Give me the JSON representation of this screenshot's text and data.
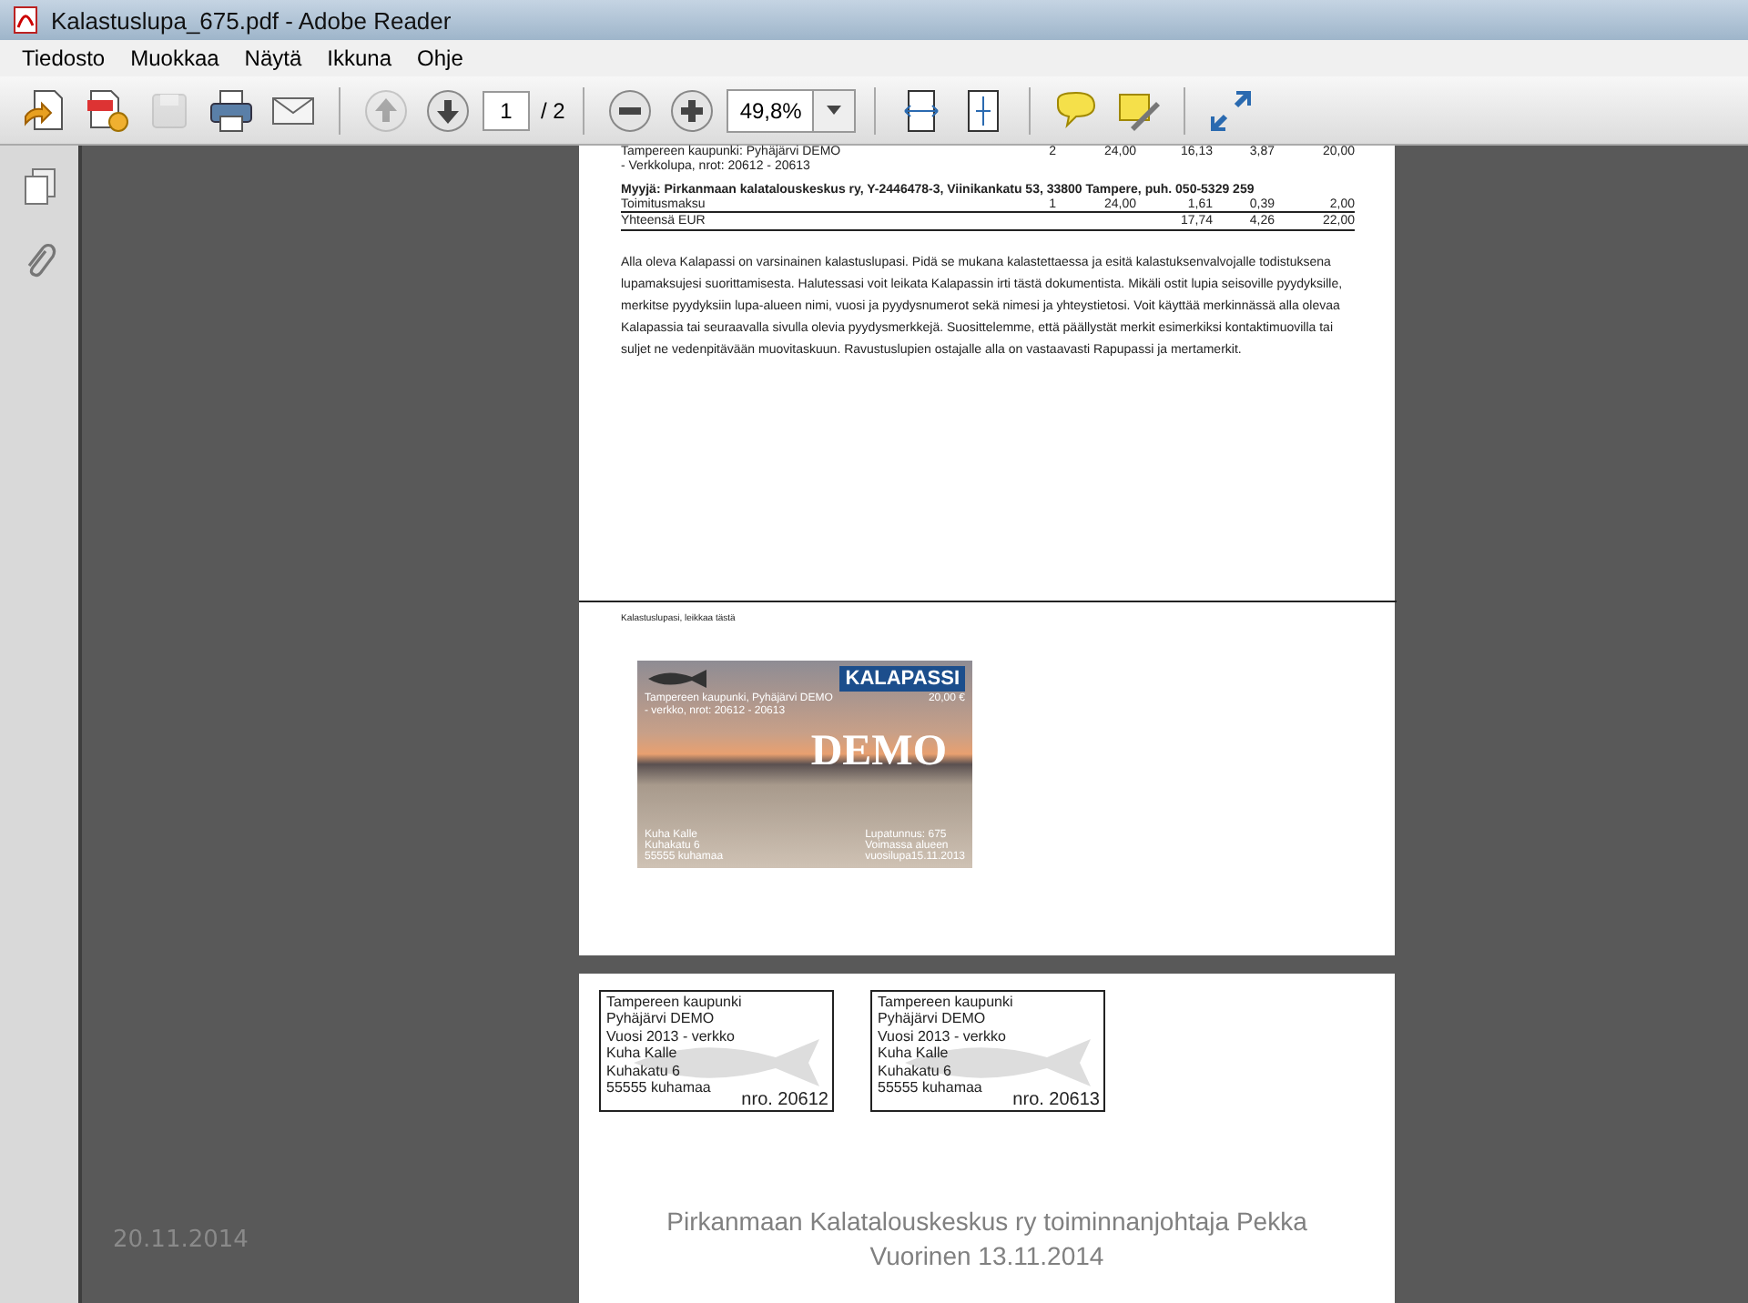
{
  "window": {
    "title": "Kalastuslupa_675.pdf - Adobe Reader"
  },
  "menu": [
    "Tiedosto",
    "Muokkaa",
    "Näytä",
    "Ikkuna",
    "Ohje"
  ],
  "toolbar": [
    {
      "items": [
        {
          "kind": "create",
          "disabled": false
        },
        {
          "kind": "convert",
          "disabled": false
        },
        {
          "kind": "save",
          "disabled": true
        },
        {
          "kind": "print",
          "disabled": false
        },
        {
          "kind": "email",
          "disabled": false
        }
      ]
    },
    {
      "items": [
        {
          "kind": "prev",
          "disabled": true
        },
        {
          "kind": "next",
          "disabled": false
        },
        {
          "kind": "page",
          "value": "1",
          "total": "/ 2",
          "disabled": false
        }
      ]
    },
    {
      "items": [
        {
          "kind": "zoom_out",
          "disabled": false
        },
        {
          "kind": "zoom_in",
          "disabled": false
        },
        {
          "kind": "zoom",
          "value": "49,8%",
          "disabled": false
        }
      ]
    },
    {
      "items": [
        {
          "kind": "fit_width",
          "disabled": false
        },
        {
          "kind": "fit_page",
          "disabled": false
        }
      ]
    },
    {
      "items": [
        {
          "kind": "comment",
          "disabled": false
        },
        {
          "kind": "highlight",
          "disabled": false
        }
      ]
    },
    {
      "items": [
        {
          "kind": "expand",
          "disabled": false
        }
      ]
    }
  ],
  "side_panel": {
    "items": [
      {
        "kind": "pages"
      },
      {
        "kind": "attachments"
      }
    ]
  },
  "document": {
    "rows": [
      {
        "description": "Tampereen kaupunki: Pyhäjärvi DEMO",
        "qty": "2",
        "price": "24,00",
        "net": "16,13",
        "vat": "3,87",
        "total": "20,00"
      }
    ],
    "row_note": "- Verkkolupa, nrot: 20612 - 20613",
    "seller": "Myyjä: Pirkanmaan kalatalouskeskus ry, Y-2446478-3, Viinikankatu 53, 33800 Tampere, puh. 050-5329 259",
    "fee_rows": [
      {
        "description": "Toimitusmaksu",
        "qty": "1",
        "price": "24,00",
        "net": "1,61",
        "vat": "0,39",
        "total": "2,00"
      }
    ],
    "sum_row": {
      "description": "Yhteensä EUR",
      "net": "17,74",
      "vat": "4,26",
      "total": "22,00"
    },
    "paragraph": "Alla oleva Kalapassi on varsinainen kalastuslupasi. Pidä se mukana kalastettaessa ja esitä kalastuksenvalvojalle todistuksena lupamaksujesi suorittamisesta. Halutessasi voit leikata Kalapassin irti tästä dokumentista. Mikäli ostit lupia seisoville pyydyksille, merkitse pyydyksiin lupa-alueen nimi, vuosi ja pyydysnumerot sekä nimesi ja yhteystietosi. Voit käyttää merkinnässä alla olevaa Kalapassia tai seuraavalla sivulla olevia pyydysmerkkejä. Suosittelemme, että päällystät merkit esimerkiksi kontaktimuovilla tai suljet ne vedenpitävään muovitaskuun. Ravustuslupien ostajalle alla on vastaavasti Rapupassi ja mertamerkit.",
    "cut_label": "Kalastuslupasi, leikkaa tästä",
    "card": {
      "logo": "KALAPASSI",
      "permit": "Tampereen kaupunki, Pyhäjärvi DEMO",
      "price": "20,00 €",
      "numbers": "- verkko, nrot: 20612 - 20613",
      "stamp": "DEMO",
      "holder": [
        "Kuha Kalle",
        "Kuhakatu 6",
        "55555 kuhamaa"
      ],
      "validity": [
        "Lupatunnus: 675",
        "Voimassa alueen",
        "vuosilupa15.11.2013"
      ]
    },
    "tags": [
      {
        "lines": [
          "Tampereen kaupunki",
          "Pyhäjärvi DEMO",
          "Vuosi 2013 - verkko",
          "Kuha Kalle",
          "Kuhakatu 6",
          "55555 kuhamaa"
        ],
        "number": "nro. 20612"
      },
      {
        "lines": [
          "Tampereen kaupunki",
          "Pyhäjärvi DEMO",
          "Vuosi 2013 - verkko",
          "Kuha Kalle",
          "Kuhakatu 6",
          "55555 kuhamaa"
        ],
        "number": "nro. 20613"
      }
    ]
  },
  "footer": {
    "date": "20.11.2014",
    "caption": "Pirkanmaan Kalatalouskeskus ry toiminnanjohtaja Pekka Vuorinen 13.11.2014"
  }
}
